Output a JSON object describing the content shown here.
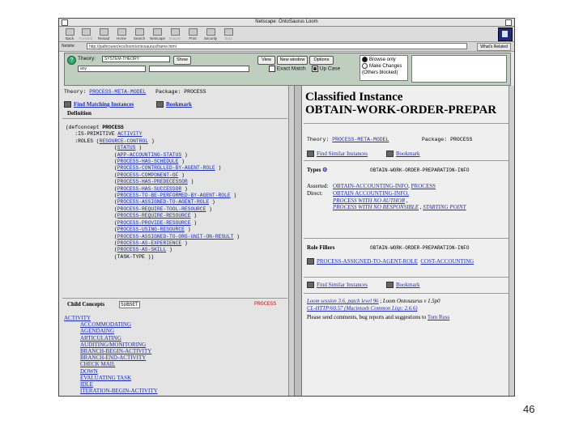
{
  "window": {
    "title": "Netscape: OntoSaurus Loom"
  },
  "toolbar": {
    "buttons": [
      "Back",
      "Forward",
      "Reload",
      "Home",
      "Search",
      "Netscape",
      "Images",
      "Print",
      "Security",
      "Stop"
    ],
    "location_label": "Netsite:",
    "location_value": "http://pathrouter/ecs/loom/ontosaurus/frame.html",
    "whats_related": "What's Related"
  },
  "controls": {
    "theory_label": "Theory:",
    "theory_value": "SYSTEM-THEORY",
    "show_button": "Show",
    "search_value": "any",
    "view_button": "View",
    "new_window_button": "New window",
    "options_button": "Options",
    "exact_match_label": "Exact Match",
    "upcase_label": "Up Case",
    "radio_browse": "Browse only",
    "radio_changes": "Make Changes",
    "radio_note": "(Others blocked)"
  },
  "left": {
    "theory_label": "Theory:",
    "theory_value": "PROCESS-META-MODEL",
    "package_label": "Package:",
    "package_value": "PROCESS",
    "find_matching": "Find Matching Instances",
    "bookmark": "Bookmark",
    "definition_label": "Definition",
    "code": {
      "defconcept": "(defconcept",
      "concept": "PROCESS",
      "is_primitive_kw": ":IS-PRIMITIVE",
      "is_primitive_val": "ACTIVITY",
      "roles_kw": ":ROLES (",
      "roles_first": "RESOURCE-CONTROL",
      "roles": [
        "STATUS",
        "APP-ACCOUNTING-STATUS",
        "PROCESS-HAS-SCHEDULE",
        "PROCESS-CONTROLLED-BY-AGENT-ROLE",
        "PROCESS-COMPONENT-OF",
        "PROCESS-HAS-PREDECESSOR",
        "PROCESS-HAS-SUCCESSOR",
        "PROCESS-TO-BE-PERFORMED-BY-AGENT-ROLE",
        "PROCESS-ASSIGNED-TO-AGENT-ROLE",
        "PROCESS-REQUIRE-TOOL-RESOURCE",
        "PROCESS-REQUIRE-RESOURCE",
        "PROCESS-PROVIDE-RESOURCE",
        "PROCESS-USING-RESOURCE",
        "PROCESS-ASSIGNED-TO-ORG-UNIT-ON-RESULT",
        "PROCESS-AS-EXPERIENCE",
        "PROCESS-AS-SKILL"
      ],
      "last": "TASK-TYPE"
    },
    "child_label": "Child Concepts",
    "child_sort": "SUBSET",
    "child_of": "PROCESS",
    "children": [
      "ACTIVITY",
      "ACCOMMODATING",
      "AGENDAING",
      "ARTICULATING",
      "AUDITING/MONITORING",
      "BRANCH-BEGIN-ACTIVITY",
      "BRANCH-END-ACTIVITY",
      "CHECK MAIL",
      "DOWN",
      "EVALUATING TASK",
      "IDLE",
      "ITERATION-BEGIN-ACTIVITY"
    ]
  },
  "right": {
    "heading": "Classified Instance",
    "instance": "OBTAIN-WORK-ORDER-PREPAR",
    "theory_label": "Theory:",
    "theory_value": "PROCESS-META-MODEL",
    "package_label": "Package:",
    "package_value": "PROCESS",
    "find_similar": "Find Similar Instances",
    "bookmark": "Bookmark",
    "types_label": "Types",
    "types_value": "OBTAIN-WORK-ORDER-PREPARATION-INFO",
    "asserted_label": "Asserted:",
    "asserted_value": "OBTAIN-ACCOUNTING-INFO",
    "asserted_value2": "PROCESS",
    "direct_label": "Direct:",
    "direct_value": "OBTAIN ACCOUNTING-INFO,",
    "direct_value2": "PROCESS WITH NO AUTHOR",
    "direct_value3": "PROCESS WITH NO RESPONSIBLE",
    "direct_value4": "STARTING POINT",
    "role_fillers_label": "Role Fillers",
    "role_fillers_value": "OBTAIN-WORK-ORDER-PREPARATION-INFO",
    "role_row": "PROCESS-ASSIGNED-TO-AGENT-ROLE",
    "role_row_value": "COST-ACCOUNTING",
    "find_similar2": "Find Similar Instances",
    "bookmark2": "Bookmark",
    "footer1": "Loom session 3.6, patch level 96",
    "footer1b": "Loom Ontosaurus v 1.5p0",
    "footer2": "CL-HTTP/60.57 (Macintosh Common Lisp: 2.6.6)",
    "footer3": "Please send comments, bug reports and suggestions to",
    "footer3_link": "Tom Russ"
  },
  "page_number": "46"
}
